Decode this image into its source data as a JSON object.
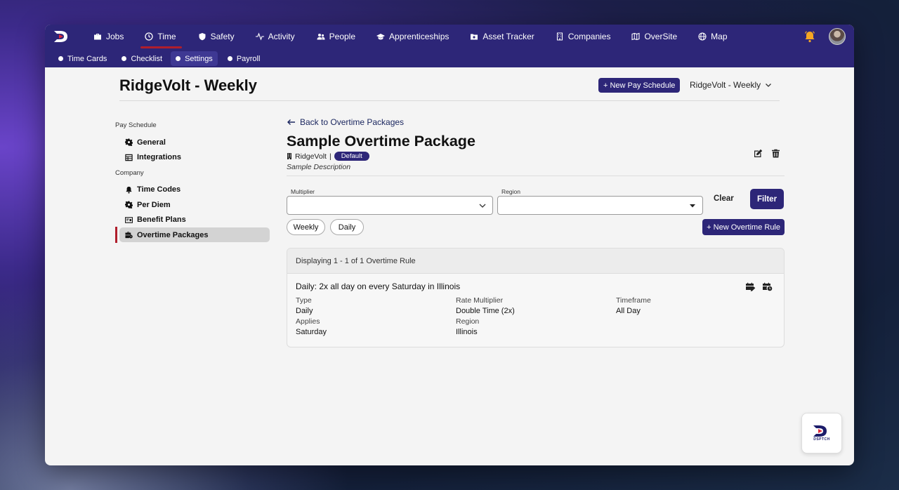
{
  "nav": {
    "items": [
      {
        "label": "Jobs",
        "icon": "briefcase-icon"
      },
      {
        "label": "Time",
        "icon": "clock-icon",
        "active": true
      },
      {
        "label": "Safety",
        "icon": "shield-icon"
      },
      {
        "label": "Activity",
        "icon": "pulse-icon"
      },
      {
        "label": "People",
        "icon": "people-icon"
      },
      {
        "label": "Apprenticeships",
        "icon": "graduation-cap-icon"
      },
      {
        "label": "Asset Tracker",
        "icon": "asset-icon"
      },
      {
        "label": "Companies",
        "icon": "building-icon"
      },
      {
        "label": "OverSite",
        "icon": "map-fold-icon"
      },
      {
        "label": "Map",
        "icon": "globe-icon"
      }
    ]
  },
  "subnav": {
    "items": [
      {
        "label": "Time Cards"
      },
      {
        "label": "Checklist"
      },
      {
        "label": "Settings",
        "active": true
      },
      {
        "label": "Payroll"
      }
    ]
  },
  "header": {
    "title": "RidgeVolt - Weekly",
    "new_pay_schedule": "+ New Pay Schedule",
    "schedule_select": "RidgeVolt - Weekly"
  },
  "sidebar": {
    "section_pay": "Pay Schedule",
    "section_company": "Company",
    "items": [
      {
        "label": "General",
        "icon": "gear-icon"
      },
      {
        "label": "Integrations",
        "icon": "table-icon"
      },
      {
        "label": "Time Codes",
        "icon": "bell-icon"
      },
      {
        "label": "Per Diem",
        "icon": "gear-icon"
      },
      {
        "label": "Benefit Plans",
        "icon": "id-card-icon"
      },
      {
        "label": "Overtime Packages",
        "icon": "briefcase-clock-icon",
        "active": true
      }
    ]
  },
  "package": {
    "back_link": "Back to Overtime Packages",
    "title": "Sample Overtime Package",
    "company": "RidgeVolt",
    "separator": "|",
    "badge": "Default",
    "description": "Sample Description"
  },
  "filters": {
    "multiplier_label": "Multiplier",
    "region_label": "Region",
    "clear": "Clear",
    "filter": "Filter"
  },
  "chips": {
    "weekly": "Weekly",
    "daily": "Daily",
    "new_rule": "+ New Overtime Rule"
  },
  "results": {
    "summary_prefix": "Displaying",
    "range": "1 - 1",
    "of": "of",
    "total": "1",
    "noun": "Overtime Rule",
    "rules": [
      {
        "title": "Daily: 2x all day on every Saturday in Illinois",
        "type_label": "Type",
        "type": "Daily",
        "rate_label": "Rate Multiplier",
        "rate": "Double Time (2x)",
        "timeframe_label": "Timeframe",
        "timeframe": "All Day",
        "applies_label": "Applies",
        "applies": "Saturday",
        "region_label": "Region",
        "region": "Illinois"
      }
    ]
  },
  "fab": {
    "label": "DSPTCH"
  },
  "colors": {
    "brand": "#2d2678",
    "accent": "#b01e2c",
    "bell": "#f5a623"
  }
}
